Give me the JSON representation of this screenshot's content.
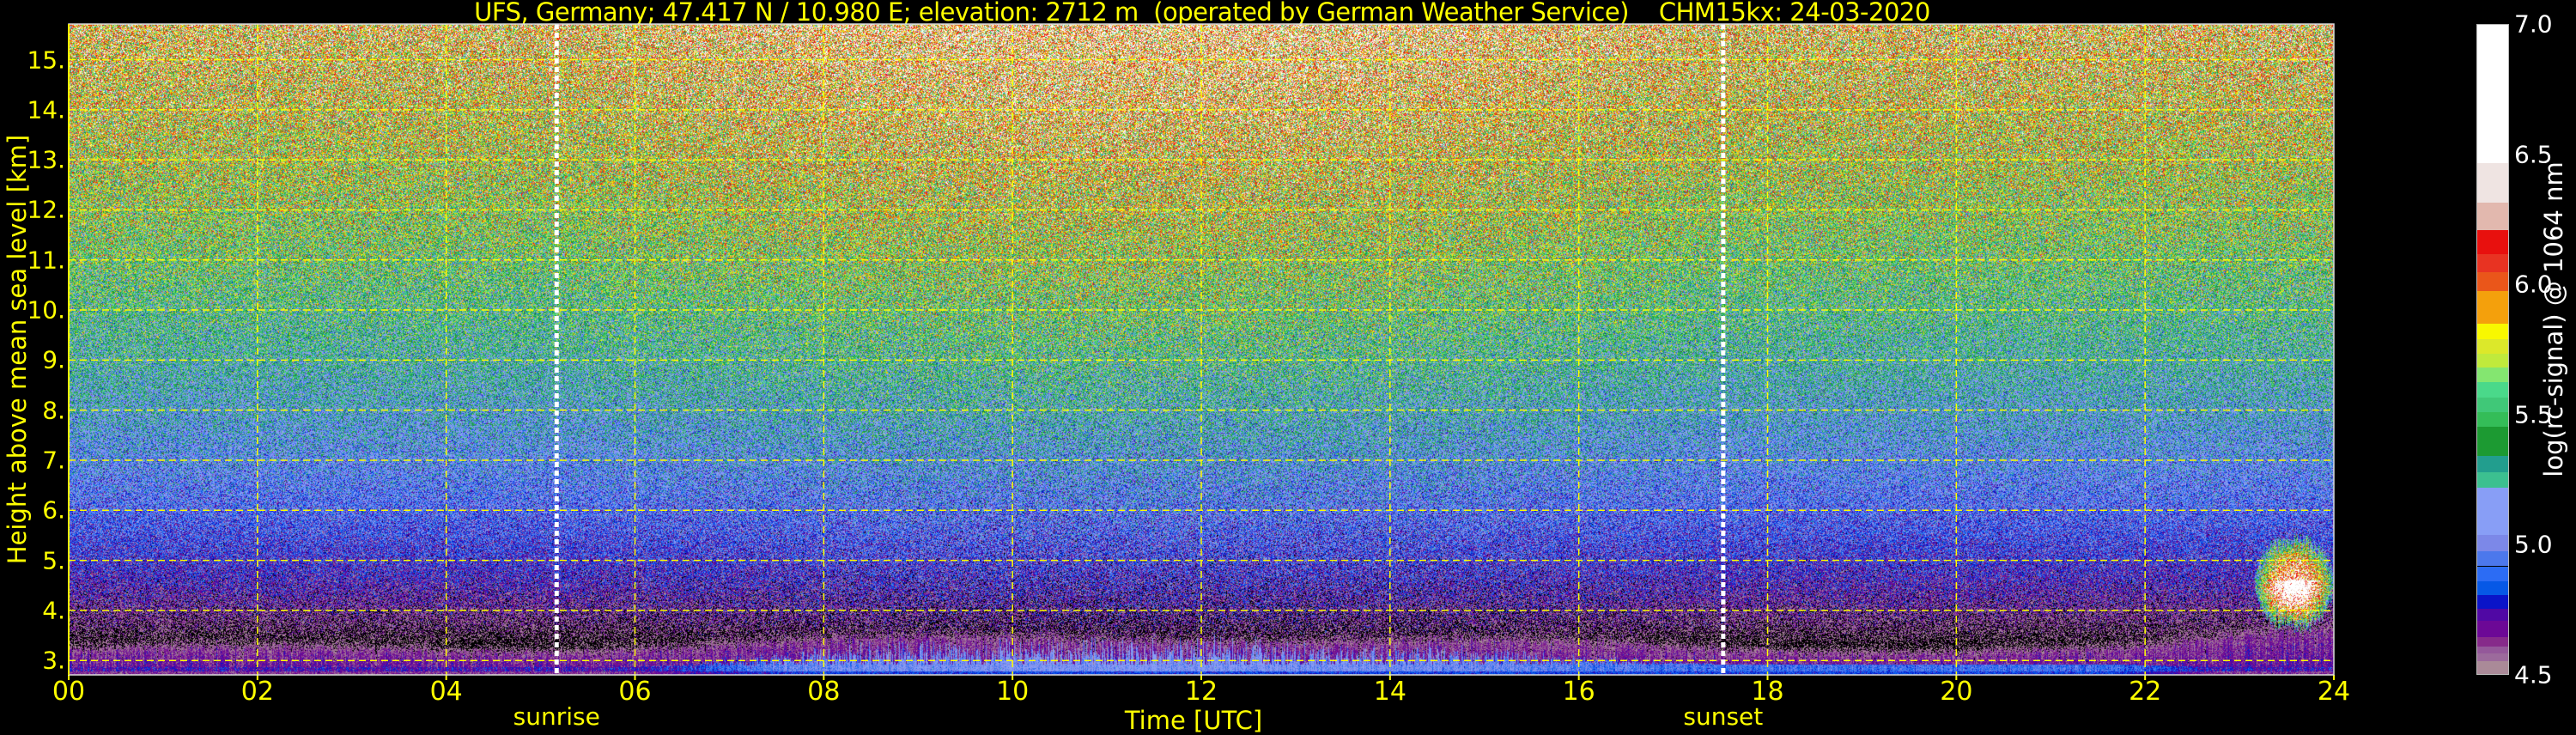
{
  "chart_data": {
    "type": "heatmap",
    "title": "UFS, Germany; 47.417 N / 10.980 E; elevation: 2712 m  (operated by German Weather Service)    CHM15kx: 24-03-2020",
    "xlabel": "Time [UTC]",
    "ylabel": "Height above mean sea level [km]",
    "xlim": [
      0,
      24
    ],
    "ylim": [
      2.712,
      15.712
    ],
    "xticks": [
      {
        "value": 0,
        "label": "00"
      },
      {
        "value": 2,
        "label": "02"
      },
      {
        "value": 4,
        "label": "04"
      },
      {
        "value": 6,
        "label": "06"
      },
      {
        "value": 8,
        "label": "08"
      },
      {
        "value": 10,
        "label": "10"
      },
      {
        "value": 12,
        "label": "12"
      },
      {
        "value": 14,
        "label": "14"
      },
      {
        "value": 16,
        "label": "16"
      },
      {
        "value": 18,
        "label": "18"
      },
      {
        "value": 20,
        "label": "20"
      },
      {
        "value": 22,
        "label": "22"
      },
      {
        "value": 24,
        "label": "24"
      }
    ],
    "yticks": [
      {
        "value": 3,
        "label": "3."
      },
      {
        "value": 4,
        "label": "4."
      },
      {
        "value": 5,
        "label": "5."
      },
      {
        "value": 6,
        "label": "6."
      },
      {
        "value": 7,
        "label": "7."
      },
      {
        "value": 8,
        "label": "8."
      },
      {
        "value": 9,
        "label": "9."
      },
      {
        "value": 10,
        "label": "10."
      },
      {
        "value": 11,
        "label": "11."
      },
      {
        "value": 12,
        "label": "12."
      },
      {
        "value": 13,
        "label": "13."
      },
      {
        "value": 14,
        "label": "14."
      },
      {
        "value": 15,
        "label": "15."
      }
    ],
    "grid": true,
    "grid_color": "#ffff00",
    "annotations": [
      {
        "label": "sunrise",
        "time": 5.17
      },
      {
        "label": "sunset",
        "time": 17.53
      }
    ],
    "features": {
      "cloud": {
        "time_range": [
          23.0,
          24.0
        ],
        "height_range": [
          3.6,
          5.6
        ]
      },
      "boundary_layer_top_km": 3.3
    },
    "colorbar": {
      "label": "log(rc-signal) @ 1064 nm",
      "range": [
        4.5,
        7.0
      ],
      "ticks": [
        {
          "value": 7.0,
          "label": "7.0"
        },
        {
          "value": 6.5,
          "label": "6.5"
        },
        {
          "value": 6.0,
          "label": "6.0"
        },
        {
          "value": 5.5,
          "label": "5.5"
        },
        {
          "value": 5.0,
          "label": "5.0"
        },
        {
          "value": 4.5,
          "label": "4.5"
        }
      ],
      "below_range_color": "#000000",
      "levels": [
        {
          "from": 4.5,
          "to": 4.55,
          "color": "#aa8a98"
        },
        {
          "from": 4.55,
          "to": 4.58,
          "color": "#9c6a9c"
        },
        {
          "from": 4.58,
          "to": 4.607,
          "color": "#94589a"
        },
        {
          "from": 4.607,
          "to": 4.643,
          "color": "#862a8a"
        },
        {
          "from": 4.643,
          "to": 4.706,
          "color": "#6c0896"
        },
        {
          "from": 4.706,
          "to": 4.75,
          "color": "#5008a4"
        },
        {
          "from": 4.75,
          "to": 4.804,
          "color": "#0a14c8"
        },
        {
          "from": 4.804,
          "to": 4.858,
          "color": "#0658e6"
        },
        {
          "from": 4.858,
          "to": 4.915,
          "color": "#2c6cf4"
        },
        {
          "from": 4.915,
          "to": 4.974,
          "color": "#4c78ec"
        },
        {
          "from": 4.974,
          "to": 5.036,
          "color": "#7c88e8"
        },
        {
          "from": 5.036,
          "to": 5.219,
          "color": "#889ef6"
        },
        {
          "from": 5.219,
          "to": 5.278,
          "color": "#3cc090"
        },
        {
          "from": 5.278,
          "to": 5.34,
          "color": "#229e8e"
        },
        {
          "from": 5.34,
          "to": 5.451,
          "color": "#1c9a32"
        },
        {
          "from": 5.451,
          "to": 5.509,
          "color": "#34bd58"
        },
        {
          "from": 5.509,
          "to": 5.566,
          "color": "#40c878"
        },
        {
          "from": 5.566,
          "to": 5.623,
          "color": "#4ad98a"
        },
        {
          "from": 5.623,
          "to": 5.68,
          "color": "#84e670"
        },
        {
          "from": 5.68,
          "to": 5.734,
          "color": "#c0ea3c"
        },
        {
          "from": 5.734,
          "to": 5.79,
          "color": "#dce82a"
        },
        {
          "from": 5.79,
          "to": 5.85,
          "color": "#f8f800"
        },
        {
          "from": 5.85,
          "to": 5.975,
          "color": "#f4a00c"
        },
        {
          "from": 5.975,
          "to": 6.047,
          "color": "#ea561a"
        },
        {
          "from": 6.047,
          "to": 6.118,
          "color": "#e83322"
        },
        {
          "from": 6.118,
          "to": 6.211,
          "color": "#e8100e"
        },
        {
          "from": 6.211,
          "to": 6.315,
          "color": "#e2b8ae"
        },
        {
          "from": 6.315,
          "to": 6.467,
          "color": "#efe4e2"
        },
        {
          "from": 6.467,
          "to": 7.0,
          "color": "#ffffff"
        }
      ]
    }
  }
}
